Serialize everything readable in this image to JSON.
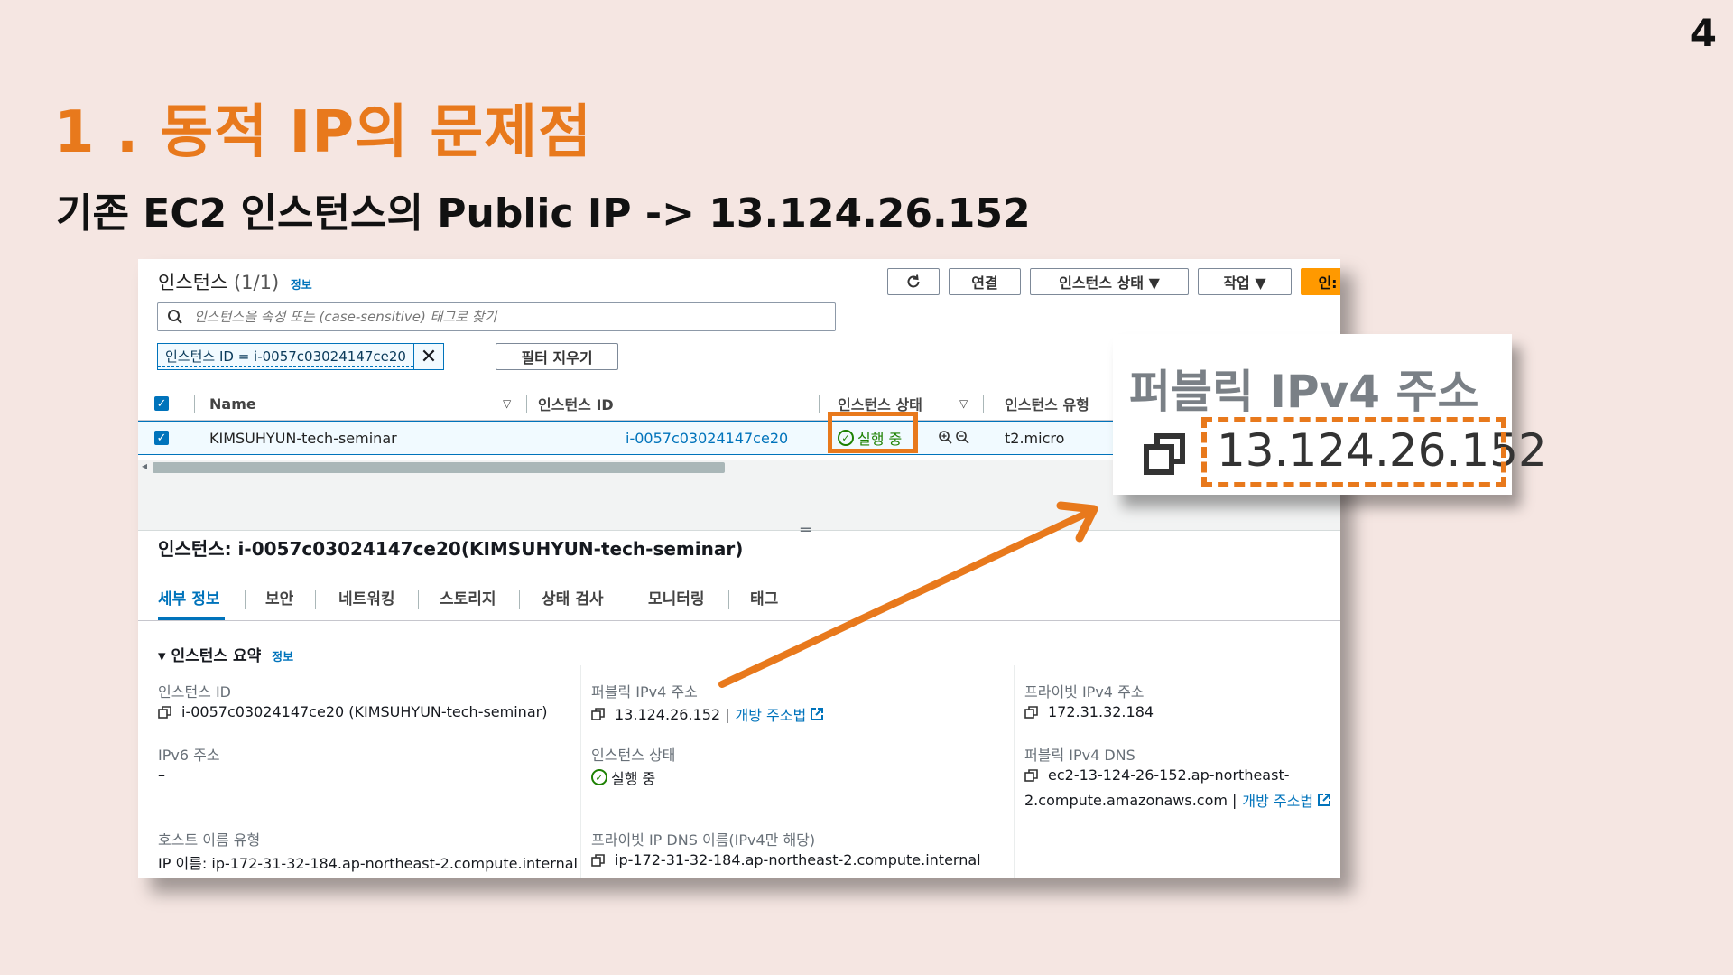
{
  "slide": {
    "page_number": "4",
    "title": "1 . 동적 IP의 문제점",
    "subtitle": "기존 EC2 인스턴스의 Public IP -> 13.124.26.152"
  },
  "colors": {
    "accent": "#e8791c",
    "aws_blue": "#0073bb",
    "running_green": "#1d8102",
    "background": "#f5e6e2"
  },
  "instances_list": {
    "title": "인스턴스",
    "count": "(1/1)",
    "info_link": "정보",
    "toolbar": {
      "refresh_icon": "refresh-icon",
      "connect": "연결",
      "instance_state": "인스턴스 상태 ▼",
      "actions": "작업 ▼",
      "launch_partial": "인:"
    },
    "search_placeholder": "인스턴스을 속성 또는 (case-sensitive) 태그로 찾기",
    "filter_token": "인스턴스 ID = i-0057c03024147ce20",
    "clear_filters": "필터 지우기",
    "columns": [
      "Name",
      "인스턴스 ID",
      "인스턴스 상태",
      "인스턴스 유형"
    ],
    "rows": [
      {
        "name": "KIMSUHYUN-tech-seminar",
        "instance_id": "i-0057c03024147ce20",
        "state": "실행 중",
        "type": "t2.micro"
      }
    ]
  },
  "detail": {
    "title": "인스턴스: i-0057c03024147ce20(KIMSUHYUN-tech-seminar)",
    "tabs": [
      "세부 정보",
      "보안",
      "네트워킹",
      "스토리지",
      "상태 검사",
      "모니터링",
      "태그"
    ],
    "active_tab": "세부 정보",
    "summary_title": "인스턴스 요약",
    "summary_info": "정보",
    "fields": {
      "instance_id_label": "인스턴스 ID",
      "instance_id_value": "i-0057c03024147ce20 (KIMSUHYUN-tech-seminar)",
      "ipv6_label": "IPv6 주소",
      "ipv6_value": "–",
      "hostname_type_label": "호스트 이름 유형",
      "hostname_type_value": "IP 이름: ip-172-31-32-184.ap-northeast-2.compute.internal",
      "public_ipv4_label": "퍼블릭 IPv4 주소",
      "public_ipv4_value": "13.124.26.152 |",
      "open_address": "개방 주소법",
      "state_label": "인스턴스 상태",
      "state_value": "실행 중",
      "private_dns_label": "프라이빗 IP DNS 이름(IPv4만 해당)",
      "private_dns_value": "ip-172-31-32-184.ap-northeast-2.compute.internal",
      "private_ipv4_label": "프라이빗 IPv4 주소",
      "private_ipv4_value": "172.31.32.184",
      "public_dns_label": "퍼블릭 IPv4 DNS",
      "public_dns_value_1": "ec2-13-124-26-152.ap-northeast-",
      "public_dns_value_2": "2.compute.amazonaws.com |",
      "open_address_2": "개방 주소법"
    }
  },
  "zoom_callout": {
    "label": "퍼블릭 IPv4 주소",
    "ip": "13.124.26.152"
  }
}
